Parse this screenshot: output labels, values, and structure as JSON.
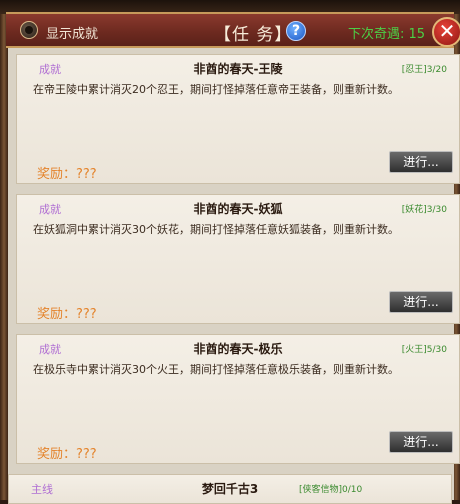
{
  "header": {
    "toggle_label": "显示成就",
    "title": "【任  务】",
    "help_icon_text": "?",
    "refresh_text": "下次奇遇: 15",
    "close_icon_text": "✕"
  },
  "quests": [
    {
      "badge": "成就",
      "name": "非酋的春天-王陵",
      "progress": "[忍王]3/20",
      "desc": "在帝王陵中累计消灭20个忍王，期间打怪掉落任意帝王装备，则重新计数。",
      "reward": "奖励：???",
      "action": "进行..."
    },
    {
      "badge": "成就",
      "name": "非酋的春天-妖狐",
      "progress": "[妖花]3/30",
      "desc": "在妖狐洞中累计消灭30个妖花，期间打怪掉落任意妖狐装备，则重新计数。",
      "reward": "奖励：???",
      "action": "进行..."
    },
    {
      "badge": "成就",
      "name": "非酋的春天-极乐",
      "progress": "[火王]5/30",
      "desc": "在极乐寺中累计消灭30个火王，期间打怪掉落任意极乐装备，则重新计数。",
      "reward": "奖励：???",
      "action": "进行..."
    }
  ],
  "partial_quest": {
    "badge": "主线",
    "name": "梦回千古3",
    "progress": "[侠客信物]0/10"
  },
  "colors": {
    "badge": "#b06fd3",
    "reward": "#e4842c",
    "progress": "#3a8a2e",
    "refresh": "#4ccf46"
  }
}
